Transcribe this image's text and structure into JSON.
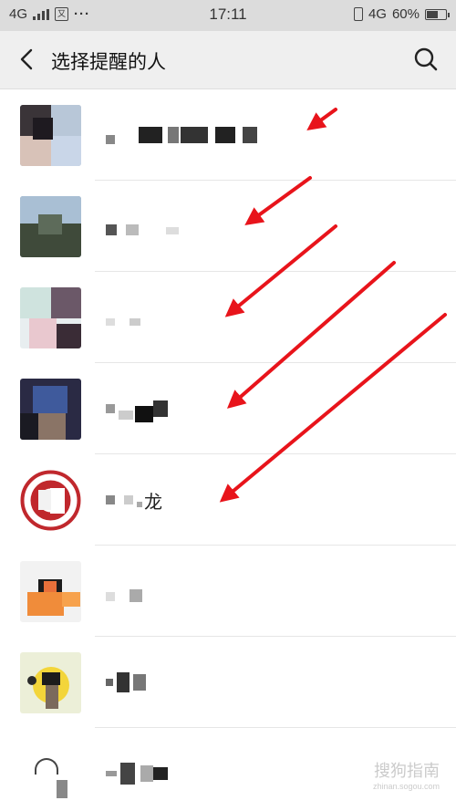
{
  "status_bar": {
    "network_left": "4G",
    "app_badge": "又",
    "dots": "···",
    "time": "17:11",
    "network_right": "4G",
    "battery_percent": "60%",
    "battery_level": 0.6
  },
  "header": {
    "title": "选择提醒的人",
    "back_icon": "chevron-left-icon",
    "search_icon": "search-icon"
  },
  "contacts": [
    {
      "name_text": ""
    },
    {
      "name_text": ""
    },
    {
      "name_text": ""
    },
    {
      "name_text": ""
    },
    {
      "name_text": "龙"
    },
    {
      "name_text": ""
    },
    {
      "name_text": ""
    },
    {
      "name_text": ""
    }
  ],
  "colors": {
    "header_bg": "#efefef",
    "status_bg": "#dcdcdc",
    "arrow": "#e8141b",
    "divider": "#e6e6e6"
  },
  "watermark": {
    "title": "搜狗指南",
    "url": "zhinan.sogou.com"
  }
}
